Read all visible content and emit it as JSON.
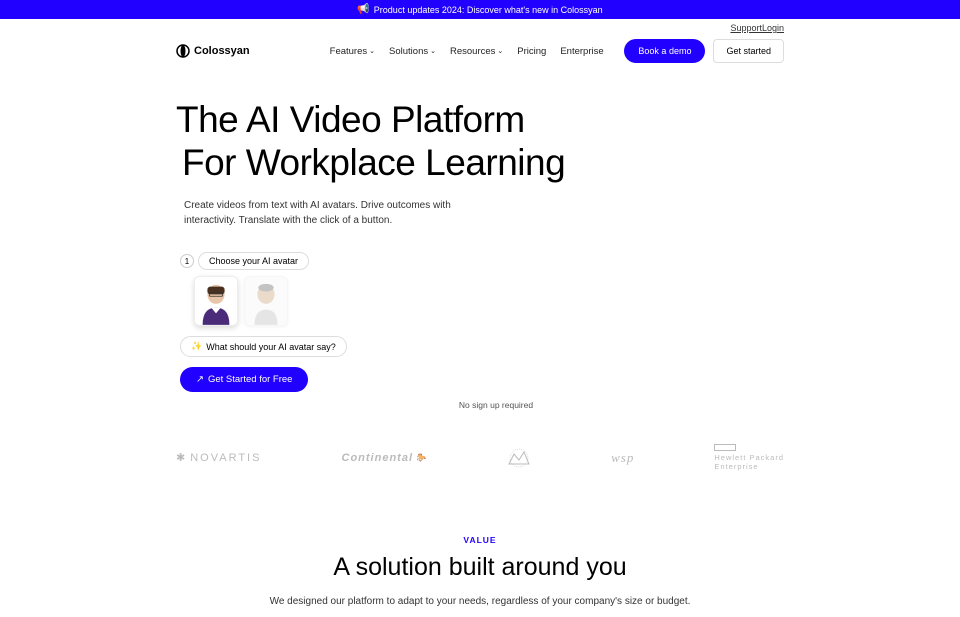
{
  "announcement": {
    "icon": "📢",
    "text": "Product updates 2024: Discover what's new in Colossyan"
  },
  "topLinks": {
    "support": "Support",
    "login": "Login"
  },
  "logo": {
    "text": "Colossyan"
  },
  "nav": {
    "features": "Features",
    "solutions": "Solutions",
    "resources": "Resources",
    "pricing": "Pricing",
    "enterprise": "Enterprise"
  },
  "actions": {
    "demo": "Book a demo",
    "start": "Get started"
  },
  "hero": {
    "titleLine1": "The AI Video Platform",
    "titleLine2": "For Workplace Learning",
    "subtitle": "Create videos from text with AI avatars. Drive outcomes with interactivity. Translate with the click of a button."
  },
  "step": {
    "num": "1",
    "label": "Choose your AI avatar"
  },
  "prompt": {
    "text": "What should your AI avatar say?"
  },
  "cta": {
    "label": "Get Started for Free",
    "note": "No sign up required"
  },
  "clients": {
    "novartis": "NOVARTIS",
    "continental": "Continental",
    "wsp": "wsp",
    "hpe1": "Hewlett Packard",
    "hpe2": "Enterprise"
  },
  "value": {
    "label": "VALUE",
    "title": "A solution built around you",
    "desc": "We designed our platform to adapt to your needs, regardless of your company's size or budget."
  }
}
